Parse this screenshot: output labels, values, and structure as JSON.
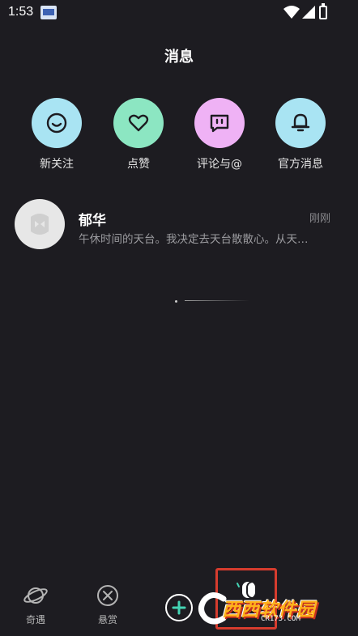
{
  "status_bar": {
    "time": "1:53",
    "icons": [
      "app-notification-icon",
      "wifi-icon",
      "signal-icon",
      "battery-icon"
    ]
  },
  "header": {
    "title": "消息"
  },
  "categories": [
    {
      "label": "新关注",
      "icon": "smile-icon",
      "color": "#a9e4f3"
    },
    {
      "label": "点赞",
      "icon": "heart-icon",
      "color": "#8ce6c2"
    },
    {
      "label": "评论与@",
      "icon": "comment-icon",
      "color": "#efb2f5"
    },
    {
      "label": "官方消息",
      "icon": "bell-icon",
      "color": "#a9e4f3"
    }
  ],
  "messages": [
    {
      "name": "郁华",
      "time": "刚刚",
      "preview": "午休时间的天台。我决定去天台散散心。从天…"
    }
  ],
  "bottom_nav": {
    "items": [
      {
        "label": "奇遇",
        "icon": "planet-icon"
      },
      {
        "label": "悬赏",
        "icon": "bounty-icon"
      }
    ],
    "add_icon": "plus-icon",
    "messages_icon": "messages-tab-icon"
  },
  "watermark": {
    "logo_text": "西西软件园",
    "url": "CR173.COM"
  },
  "colors": {
    "background": "#1d1c21",
    "highlight_box": "#d63c2e"
  }
}
